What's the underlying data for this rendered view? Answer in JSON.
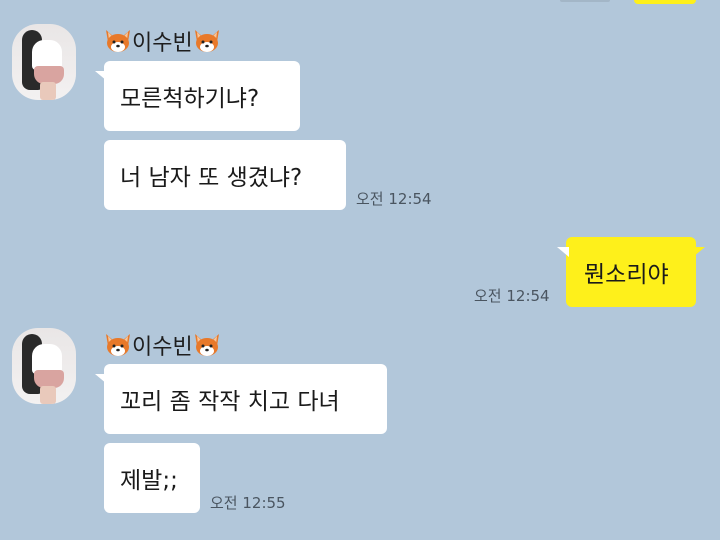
{
  "chat": {
    "groups": [
      {
        "sender": "이수빈",
        "avatar": "profile-photo",
        "messages": [
          "모른척하기냐?",
          "너 남자 또 생겼냐?"
        ],
        "time": "오전 12:54"
      },
      {
        "sender": "이수빈",
        "avatar": "profile-photo",
        "messages": [
          "꼬리 좀 작작 치고 다녀",
          "제발;;"
        ],
        "time": "오전 12:55"
      }
    ],
    "my_message": {
      "text": "뭔소리야",
      "time": "오전 12:54"
    }
  },
  "icons": {
    "name_decoration": "fox-face-icon"
  },
  "colors": {
    "background": "#b2c7da",
    "my_bubble": "#fef01b",
    "their_bubble": "#ffffff"
  }
}
